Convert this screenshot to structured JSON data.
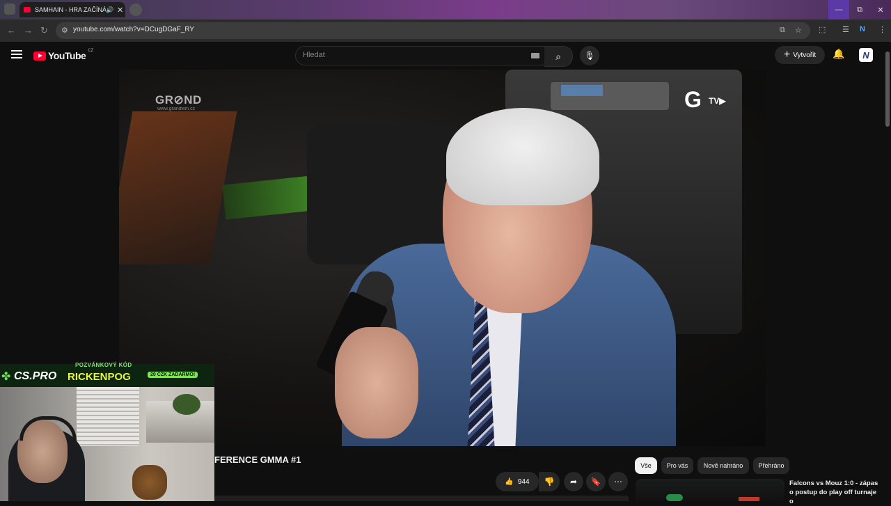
{
  "browser": {
    "tab_title": "SAMHAIN - HRA ZAČÍNÁ |",
    "url": "youtube.com/watch?v=DCugDGaF_RY",
    "window_controls": {
      "minimize": "—",
      "restore": "⧉",
      "close": "✕"
    }
  },
  "youtube": {
    "logo_text": "YouTube",
    "country_code": "CZ",
    "search_placeholder": "Hledat",
    "create_label": "Vytvořit"
  },
  "video": {
    "watermark_brand": "GR⊘ND",
    "watermark_site": "www.grandwin.cz",
    "channel_bug": "G",
    "channel_bug_label": "TV▶",
    "title": "FERENCE GMMA #1",
    "likes": "944"
  },
  "stream_overlay": {
    "brand": "CS.PRO",
    "invite_label": "POZVÁNKOVÝ KÓD",
    "invite_code": "RICKENPOG",
    "promo": "20 CZK ZADARMO!"
  },
  "sidebar": {
    "chips": [
      "Vše",
      "Pro vás",
      "Nově nahráno",
      "Přehráno"
    ],
    "related_title": "Falcons vs Mouz 1:0 - zápas o postup do play off turnaje o"
  }
}
